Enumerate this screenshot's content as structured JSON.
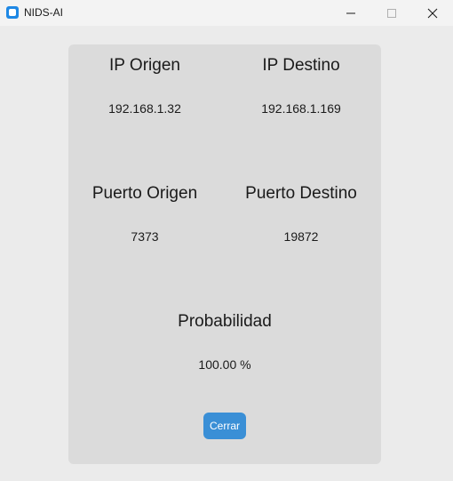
{
  "window": {
    "title": "NIDS-AI",
    "icon": "app-icon",
    "controls": [
      "minimize-icon",
      "maximize-icon",
      "close-icon"
    ]
  },
  "panel": {
    "ip_origen": {
      "label": "IP Origen",
      "value": "192.168.1.32"
    },
    "ip_destino": {
      "label": "IP Destino",
      "value": "192.168.1.169"
    },
    "puerto_origen": {
      "label": "Puerto Origen",
      "value": "7373"
    },
    "puerto_destino": {
      "label": "Puerto Destino",
      "value": "19872"
    },
    "probabilidad": {
      "label": "Probabilidad",
      "value": "100.00 %"
    },
    "close_label": "Cerrar"
  },
  "colors": {
    "background": "#ebebeb",
    "panel": "#dbdbdb",
    "button": "#3a8fd6"
  }
}
